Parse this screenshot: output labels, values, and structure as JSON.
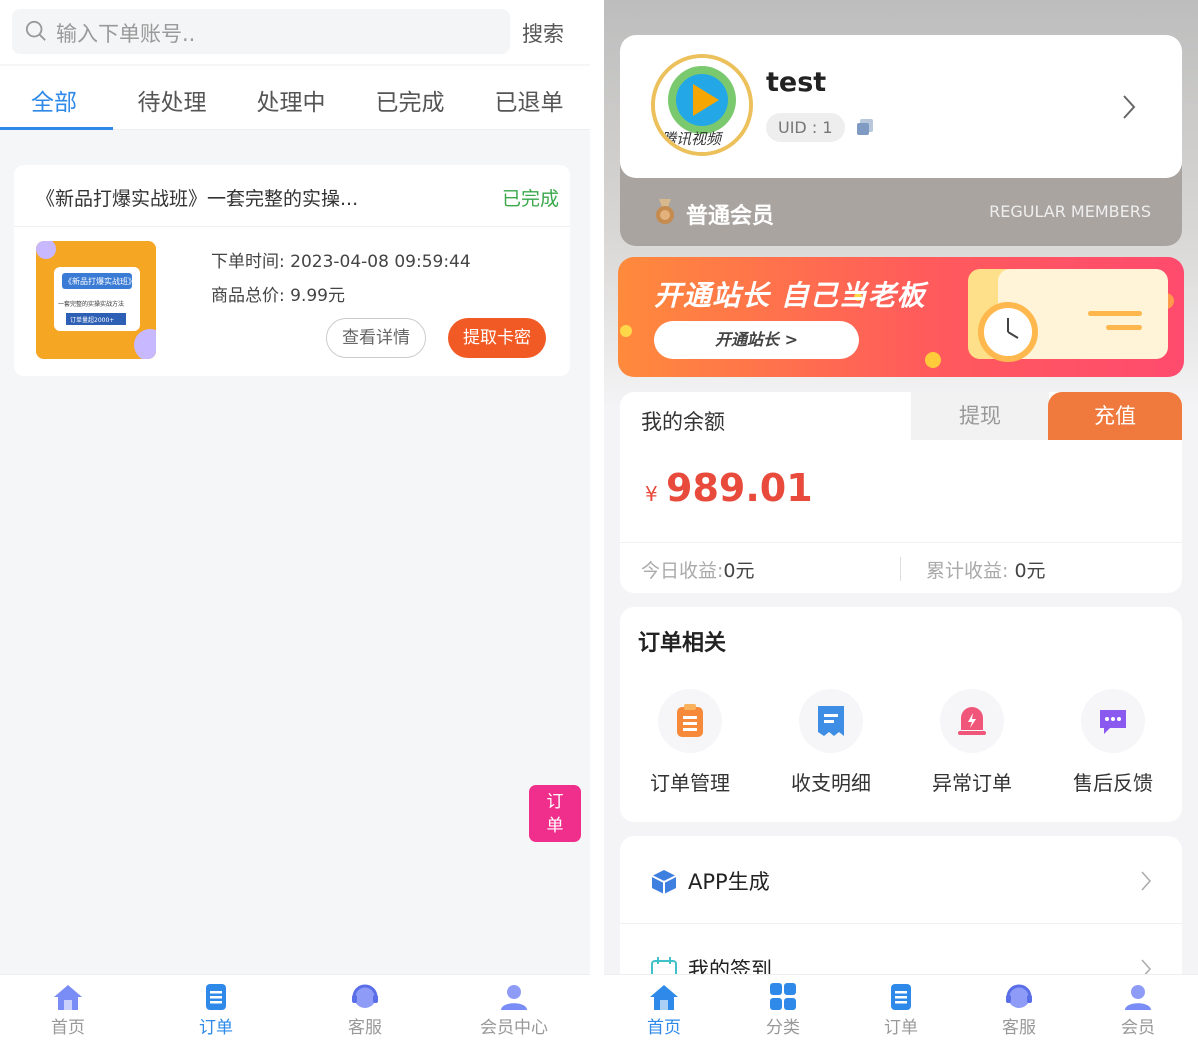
{
  "left": {
    "search": {
      "placeholder": "输入下单账号..",
      "button": "搜索"
    },
    "tabs": [
      {
        "label": "全部",
        "active": true
      },
      {
        "label": "待处理",
        "active": false
      },
      {
        "label": "处理中",
        "active": false
      },
      {
        "label": "已完成",
        "active": false
      },
      {
        "label": "已退单",
        "active": false
      }
    ],
    "order": {
      "title": "《新品打爆实战班》一套完整的实操...",
      "status": "已完成",
      "time_label": "下单时间:",
      "time_value": "2023-04-08 09:59:44",
      "price_label": "商品总价:",
      "price_value": "9.99元",
      "detail_button": "查看详情",
      "card_button": "提取卡密",
      "thumb_title": "《新品打爆实战班》",
      "thumb_sub": "一套完整的实操实战方法",
      "thumb_badge": "订单量超2000+"
    },
    "float_button": "订单",
    "nav": [
      {
        "label": "首页",
        "icon": "home-icon",
        "active": false
      },
      {
        "label": "订单",
        "icon": "order-icon",
        "active": true
      },
      {
        "label": "客服",
        "icon": "service-icon",
        "active": false
      },
      {
        "label": "会员中心",
        "icon": "member-icon",
        "active": false
      }
    ],
    "colors": {
      "accent": "#2e89e8",
      "done": "#3aa84b",
      "primary_button": "#f15a24",
      "float": "#f02e8c"
    }
  },
  "right": {
    "user": {
      "name": "test",
      "uid": "UID : 1",
      "avatar_text": "腾讯视频"
    },
    "member": {
      "level": "普通会员",
      "level_en": "REGULAR MEMBERS"
    },
    "banner": {
      "title": "开通站长 自己当老板",
      "button": "开通站长 >"
    },
    "balance": {
      "label": "我的余额",
      "withdraw": "提现",
      "recharge": "充值",
      "currency": "¥",
      "amount": "989.01",
      "today_label": "今日收益:",
      "today_value": "0元",
      "total_label": "累计收益:",
      "total_value": "0元"
    },
    "orders": {
      "title": "订单相关",
      "items": [
        {
          "label": "订单管理",
          "icon": "order-manage-icon"
        },
        {
          "label": "收支明细",
          "icon": "bill-icon"
        },
        {
          "label": "异常订单",
          "icon": "alert-icon"
        },
        {
          "label": "售后反馈",
          "icon": "feedback-icon"
        }
      ]
    },
    "menu": [
      {
        "label": "APP生成",
        "icon": "cube-icon"
      },
      {
        "label": "我的签到",
        "icon": "calendar-icon"
      }
    ],
    "nav": [
      {
        "label": "首页",
        "icon": "home-icon",
        "active": true
      },
      {
        "label": "分类",
        "icon": "grid-icon",
        "active": false
      },
      {
        "label": "订单",
        "icon": "order-icon",
        "active": false
      },
      {
        "label": "客服",
        "icon": "service-icon",
        "active": false
      },
      {
        "label": "会员",
        "icon": "member-icon",
        "active": false
      }
    ],
    "colors": {
      "amount": "#e84a3c",
      "recharge": "#f07a3d",
      "accent": "#2e89e8"
    }
  }
}
